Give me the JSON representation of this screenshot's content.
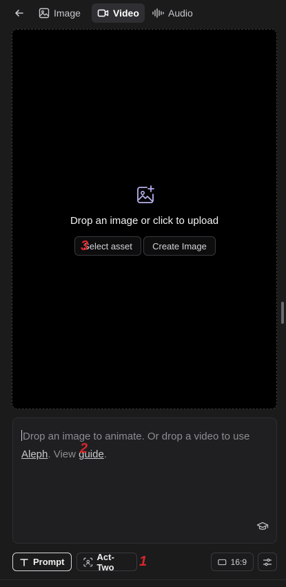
{
  "topbar": {
    "tabs": [
      {
        "label": "Image",
        "icon": "image-icon",
        "active": false
      },
      {
        "label": "Video",
        "icon": "video-icon",
        "active": true
      },
      {
        "label": "Audio",
        "icon": "audio-wave-icon",
        "active": false
      }
    ]
  },
  "upload": {
    "title": "Drop an image or click to upload",
    "select_asset_label": "Select asset",
    "create_image_label": "Create Image"
  },
  "prompt": {
    "placeholder_lead": "Drop an image to animate. Or drop a video to use",
    "link_aleph": "Aleph",
    "mid_text": ". View ",
    "link_guide": "guide",
    "tail_text": "."
  },
  "toolbar": {
    "prompt_label": "Prompt",
    "act_two_label": "Act-Two",
    "aspect_ratio": "16:9"
  },
  "annotations": {
    "one": "1",
    "two": "2",
    "three": "3",
    "color": "#d8262b"
  },
  "colors": {
    "background": "#1b1b1c",
    "dropzone": "#000000",
    "active_tab": "#2f2f33"
  }
}
